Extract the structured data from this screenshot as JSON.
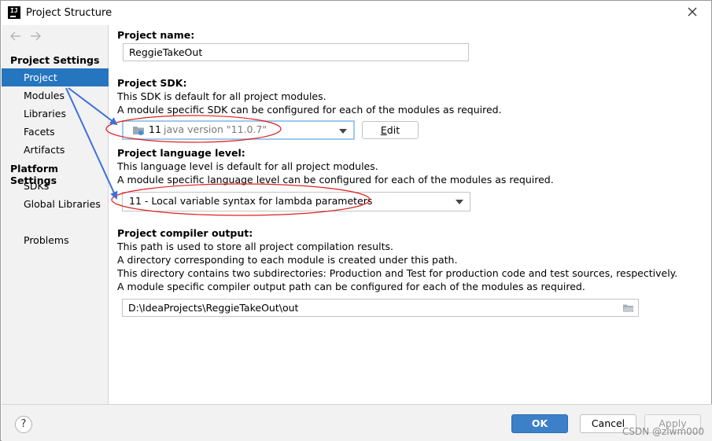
{
  "window": {
    "title": "Project Structure"
  },
  "sidebar": {
    "project_settings_title": "Project Settings",
    "project_settings_items": [
      "Project",
      "Modules",
      "Libraries",
      "Facets",
      "Artifacts"
    ],
    "platform_settings_title": "Platform Settings",
    "platform_settings_items": [
      "SDKs",
      "Global Libraries"
    ],
    "problems": "Problems",
    "selected": "Project"
  },
  "project_name": {
    "label": "Project name:",
    "value": "ReggieTakeOut"
  },
  "project_sdk": {
    "label": "Project SDK:",
    "desc1": "This SDK is default for all project modules.",
    "desc2": "A module specific SDK can be configured for each of the modules as required.",
    "sdk_name": "11",
    "sdk_version": "java version \"11.0.7\"",
    "edit_label": "Edit"
  },
  "language_level": {
    "label": "Project language level:",
    "desc1": "This language level is default for all project modules.",
    "desc2": "A module specific language level can be configured for each of the modules as required.",
    "value": "11 - Local variable syntax for lambda parameters"
  },
  "compiler_output": {
    "label": "Project compiler output:",
    "desc1": "This path is used to store all project compilation results.",
    "desc2": "A directory corresponding to each module is created under this path.",
    "desc3": "This directory contains two subdirectories: Production and Test for production code and test sources, respectively.",
    "desc4": "A module specific compiler output path can be configured for each of the modules as required.",
    "value": "D:\\IdeaProjects\\ReggieTakeOut\\out"
  },
  "footer": {
    "help": "?",
    "ok": "OK",
    "cancel": "Cancel",
    "apply": "Apply",
    "watermark": "CSDN @zlwm000"
  },
  "colors": {
    "selection": "#2675bf",
    "ok_button": "#3c80c8",
    "annotation_ellipse": "#e02020",
    "annotation_arrow": "#3f6fd8"
  }
}
